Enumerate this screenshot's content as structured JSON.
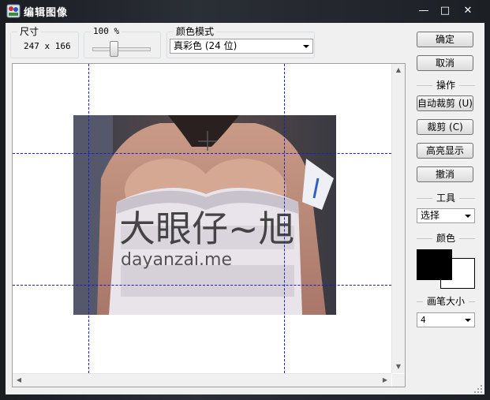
{
  "window": {
    "title": "编辑图像",
    "minimize_glyph": "—",
    "maximize_glyph": "□",
    "close_glyph": "✕"
  },
  "size_group": {
    "label": "尺寸",
    "value": "247 x 166"
  },
  "zoom_group": {
    "label": "100 %",
    "zoom_percent": 100
  },
  "color_mode_group": {
    "label": "颜色模式",
    "selected": "真彩色 (24 位)"
  },
  "buttons": {
    "ok": "确定",
    "cancel": "取消",
    "auto_crop": "自动裁剪 (U)",
    "crop": "裁剪 (C)",
    "highlight": "高亮显示",
    "undo": "撤消"
  },
  "sections": {
    "operations": "操作",
    "tools": "工具",
    "color": "颜色",
    "brush_size": "画笔大小"
  },
  "tool_select": {
    "selected": "选择"
  },
  "brush_select": {
    "selected": "4"
  },
  "colors": {
    "foreground": "#000000",
    "background": "#ffffff",
    "selection_line": "#1c1cc8"
  },
  "watermark": {
    "line1": "大眼仔~旭",
    "line2": "dayanzai.me"
  }
}
